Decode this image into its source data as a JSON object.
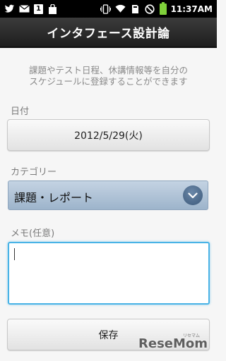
{
  "status_bar": {
    "time": "11:37AM",
    "calendar_day": "1"
  },
  "header": {
    "title": "インタフェース設計論"
  },
  "description": {
    "line1": "課題やテスト日程、休講情報等を自分の",
    "line2": "スケジュールに登録することができます"
  },
  "date_field": {
    "label": "日付",
    "value": "2012/5/29(火)"
  },
  "category_field": {
    "label": "カテゴリー",
    "value": "課題・レポート"
  },
  "memo_field": {
    "label": "メモ(任意)",
    "value": ""
  },
  "save_button": {
    "label": "保存"
  },
  "watermark": {
    "text": "ReseMom",
    "small_text": "リセマム"
  },
  "colors": {
    "titlebar": "#2b2b2b",
    "select_bg": "#b0c4d8",
    "focus_border": "#49b3e6"
  }
}
